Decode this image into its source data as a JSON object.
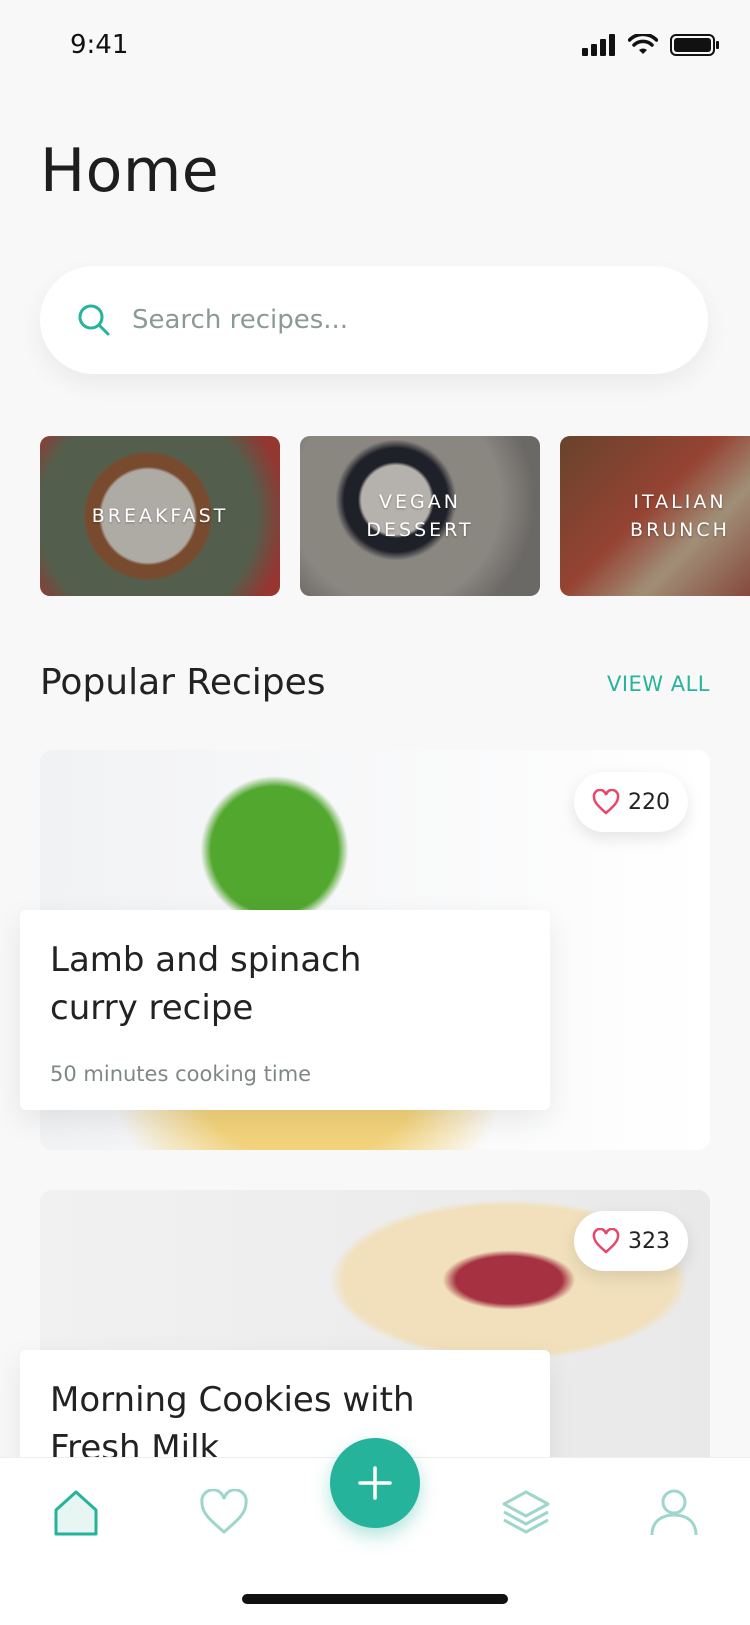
{
  "status_bar": {
    "time": "9:41"
  },
  "header": {
    "title": "Home"
  },
  "search": {
    "placeholder": "Search recipes..."
  },
  "categories": [
    {
      "label": "BREAKFAST"
    },
    {
      "label": "VEGAN\nDESSERT"
    },
    {
      "label": "ITALIAN\nBRUNCH"
    }
  ],
  "popular": {
    "title": "Popular Recipes",
    "view_all": "VIEW ALL",
    "recipes": [
      {
        "title": "Lamb and spinach\ncurry recipe",
        "meta": "50 minutes cooking time",
        "likes": "220"
      },
      {
        "title": "Morning Cookies with\nFresh Milk",
        "likes": "323"
      }
    ]
  },
  "colors": {
    "accent": "#26b39b",
    "heart": "#e8476b",
    "background": "#f8f8f9"
  },
  "icons": {
    "search": "search-icon",
    "heart": "heart-icon",
    "home": "home-icon",
    "favorites": "heart-outline-icon",
    "add": "plus-icon",
    "layers": "layers-icon",
    "profile": "user-icon"
  }
}
